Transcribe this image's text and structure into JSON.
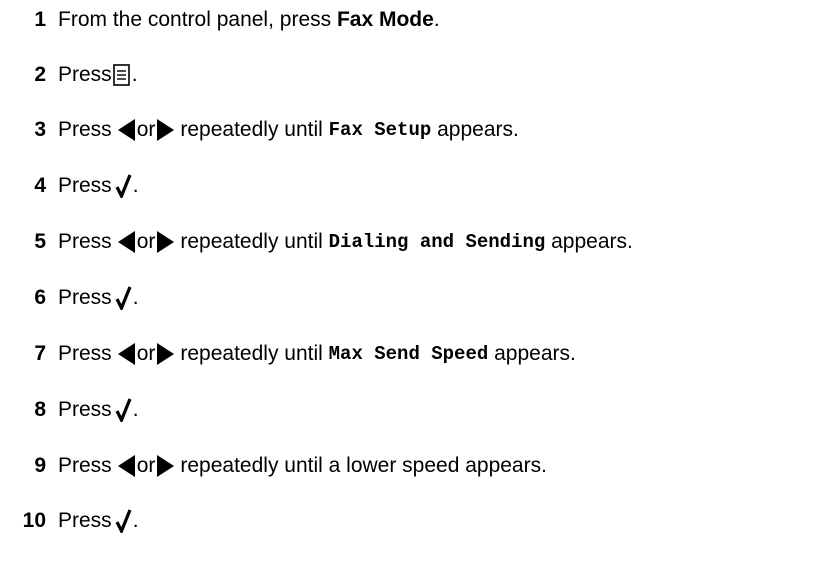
{
  "steps": [
    {
      "number": "1",
      "text_a": "From the control panel, press ",
      "bold": "Fax Mode",
      "text_b": "."
    },
    {
      "number": "2",
      "text_a": "Press",
      "icon": "menu-icon",
      "text_b": "."
    },
    {
      "number": "3",
      "text_a": "Press",
      "text_or": "or",
      "text_until": "repeatedly until ",
      "code": "Fax Setup",
      "text_b": " appears."
    },
    {
      "number": "4",
      "text_a": "Press",
      "icon": "checkmark-icon",
      "text_b": "."
    },
    {
      "number": "5",
      "text_a": "Press",
      "text_or": "or",
      "text_until": "repeatedly until ",
      "code": "Dialing and Sending",
      "text_b": " appears."
    },
    {
      "number": "6",
      "text_a": "Press",
      "icon": "checkmark-icon",
      "text_b": "."
    },
    {
      "number": "7",
      "text_a": "Press",
      "text_or": "or",
      "text_until": "repeatedly until ",
      "code": "Max Send Speed",
      "text_b": " appears."
    },
    {
      "number": "8",
      "text_a": "Press",
      "icon": "checkmark-icon",
      "text_b": "."
    },
    {
      "number": "9",
      "text_a": "Press",
      "text_or": "or",
      "text_until": "repeatedly until a lower speed appears."
    },
    {
      "number": "10",
      "text_a": "Press",
      "icon": "checkmark-icon",
      "text_b": "."
    }
  ],
  "icons": {
    "left_arrow": "left-arrow-icon",
    "right_arrow": "right-arrow-icon",
    "menu": "menu-icon",
    "check": "checkmark-icon"
  },
  "colors": {
    "text": "#000000",
    "background": "#ffffff"
  }
}
